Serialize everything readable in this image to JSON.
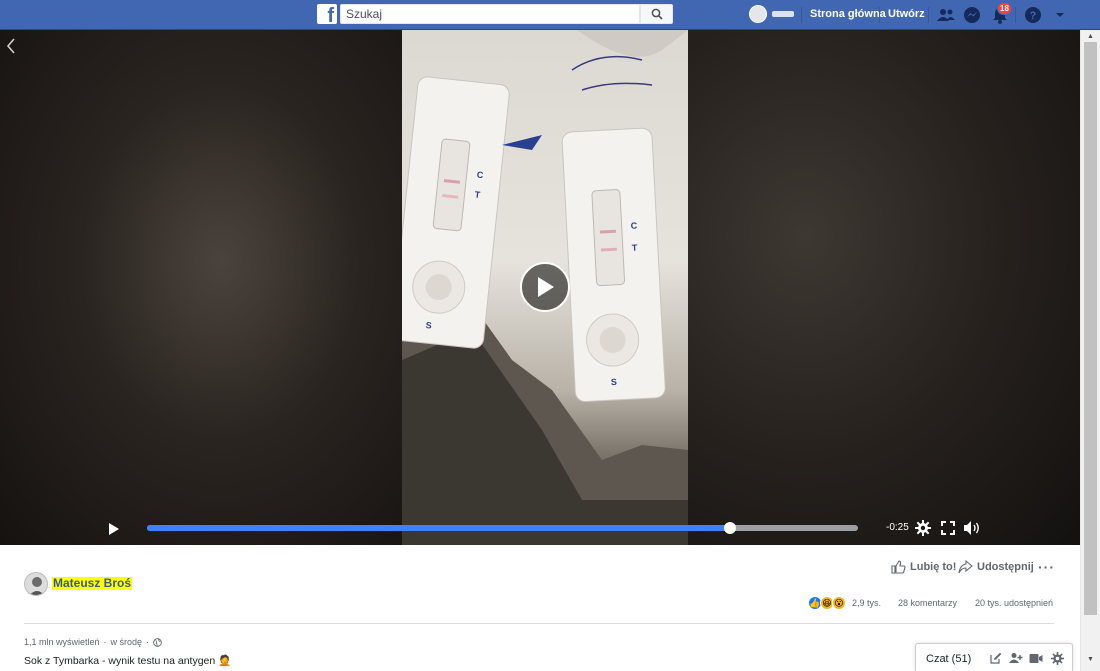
{
  "topbar": {
    "logo": "f",
    "search_placeholder": "Szukaj",
    "home_label": "Strona główna",
    "create_label": "Utwórz",
    "notification_count": "18",
    "icons": [
      "search-icon",
      "friends-icon",
      "messenger-icon",
      "bell-icon",
      "help-icon",
      "caret-down-icon"
    ]
  },
  "video": {
    "time_remaining": "-0:25",
    "progress": 0.82,
    "icons": [
      "back-icon",
      "play-icon",
      "settings-icon",
      "fullscreen-icon",
      "volume-icon"
    ]
  },
  "post": {
    "author": "Mateusz Broś",
    "like_label": "Lubię to!",
    "share_label": "Udostępnij",
    "more_label": "···",
    "reactions": [
      "like",
      "haha",
      "wow"
    ],
    "reaction_count": "2,9 tys.",
    "comments": "28 komentarzy",
    "shares": "20 tys. udostępnień",
    "views": "1,1 mln wyświetleń",
    "when": "w środę",
    "caption": "Sok z Tymbarka - wynik testu na antygen 🤦"
  },
  "chat": {
    "label": "Czat (51)",
    "icons": [
      "compose-icon",
      "new-group-icon",
      "video-call-icon",
      "gear-icon"
    ]
  },
  "colors": {
    "brand": "#4267b2",
    "progress": "#4080ff",
    "badge": "#fa3e3e"
  }
}
